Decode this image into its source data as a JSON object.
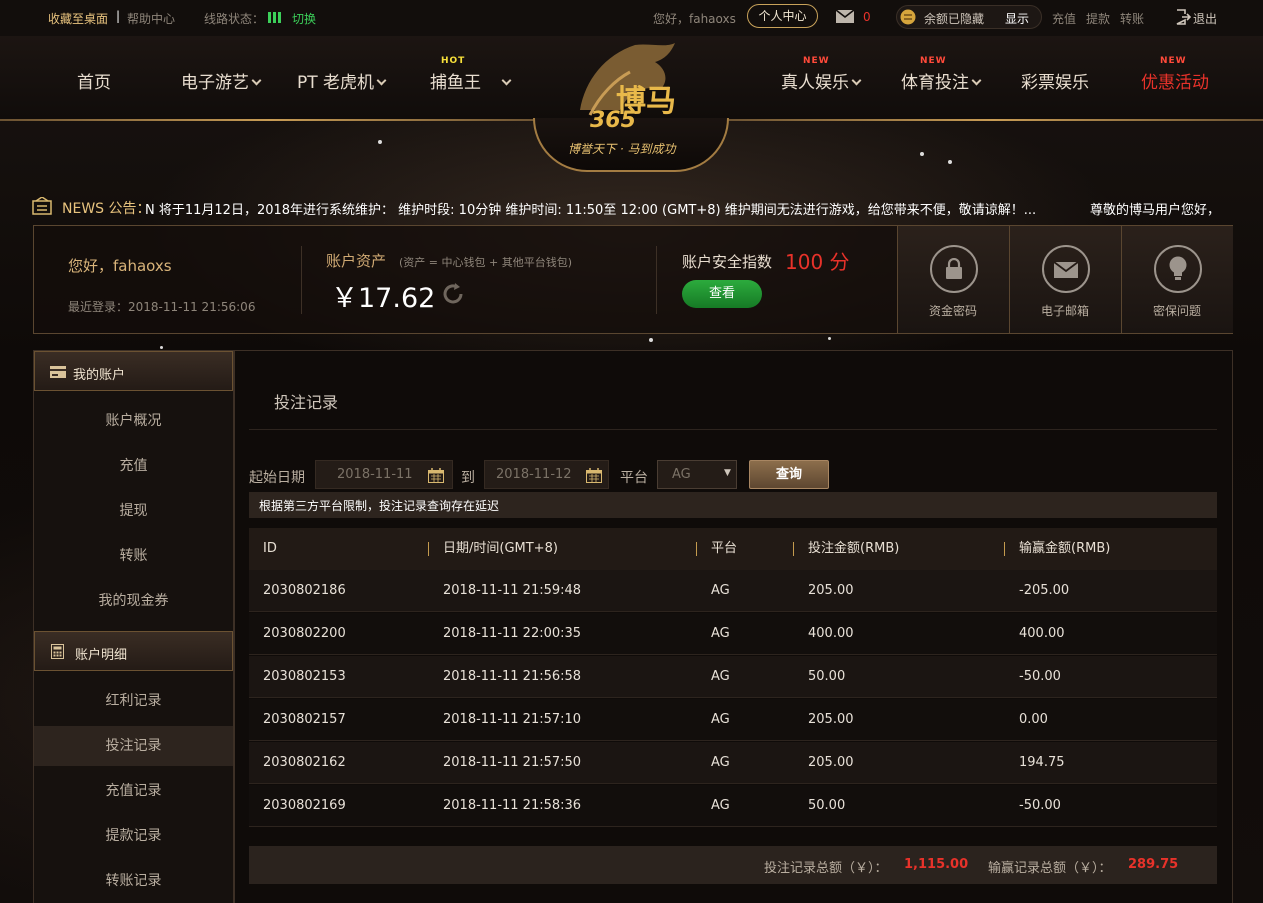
{
  "topbar": {
    "bookmark": "收藏至桌面",
    "help": "帮助中心",
    "line_status_label": "线路状态：",
    "switch": "切换",
    "greeting": "您好，fahaoxs",
    "personal_center": "个人中心",
    "mail_count": "0",
    "balance_hidden": "余额已隐藏",
    "show": "显示",
    "deposit": "充值",
    "withdraw": "提款",
    "transfer": "转账",
    "logout": "退出"
  },
  "nav": {
    "items": [
      {
        "label": "首页"
      },
      {
        "label": "电子游艺"
      },
      {
        "label": "PT 老虎机"
      },
      {
        "label": "捕鱼王",
        "badge": "HOT"
      },
      {
        "label": "真人娱乐",
        "badge": "NEW"
      },
      {
        "label": "体育投注",
        "badge": "NEW"
      },
      {
        "label": "彩票娱乐"
      },
      {
        "label": "优惠活动",
        "badge": "NEW"
      }
    ],
    "logo_text": "博马",
    "logo_number": "365",
    "logo_slogan": "博誉天下 · 马到成功"
  },
  "news": {
    "label": "NEWS 公告：",
    "text": "N 将于11月12日，2018年进行系统维护： 维护时段: 10分钟 维护时间: 11:50至 12:00 (GMT+8) 维护期间无法进行游戏，给您带来不便，敬请谅解！...",
    "text2": "尊敬的博马用户您好，"
  },
  "account": {
    "greeting": "您好，fahaoxs",
    "last_login": "最近登录：2018-11-11 21:56:06",
    "assets_label": "账户资产",
    "assets_note": "(资产 = 中心钱包 + 其他平台钱包)",
    "balance": "￥17.62",
    "security_label": "账户安全指数",
    "security_score": "100 分",
    "check_button": "查看",
    "icons": [
      {
        "label": "资金密码",
        "icon": "lock-icon"
      },
      {
        "label": "电子邮箱",
        "icon": "mail-icon"
      },
      {
        "label": "密保问题",
        "icon": "bulb-icon"
      }
    ]
  },
  "sidebar": {
    "section1": "我的账户",
    "items1": [
      "账户概况",
      "充值",
      "提现",
      "转账",
      "我的现金券"
    ],
    "section2": "账户明细",
    "items2": [
      "红利记录",
      "投注记录",
      "充值记录",
      "提款记录",
      "转账记录"
    ]
  },
  "main": {
    "title": "投注记录",
    "start_label": "起始日期",
    "start_value": "2018-11-11",
    "to_label": "到",
    "end_value": "2018-11-12",
    "platform_label": "平台",
    "platform_value": "AG",
    "query_button": "查询",
    "notice": "根据第三方平台限制，投注记录查询存在延迟",
    "columns": [
      "ID",
      "日期/时间(GMT+8)",
      "平台",
      "投注金额(RMB)",
      "输赢金额(RMB)"
    ],
    "rows": [
      [
        "2030802186",
        "2018-11-11 21:59:48",
        "AG",
        "205.00",
        "-205.00"
      ],
      [
        "2030802200",
        "2018-11-11 22:00:35",
        "AG",
        "400.00",
        "400.00"
      ],
      [
        "2030802153",
        "2018-11-11 21:56:58",
        "AG",
        "50.00",
        "-50.00"
      ],
      [
        "2030802157",
        "2018-11-11 21:57:10",
        "AG",
        "205.00",
        "0.00"
      ],
      [
        "2030802162",
        "2018-11-11 21:57:50",
        "AG",
        "205.00",
        "194.75"
      ],
      [
        "2030802169",
        "2018-11-11 21:58:36",
        "AG",
        "50.00",
        "-50.00"
      ]
    ],
    "total_bet_label": "投注记录总额（￥）：",
    "total_bet": "1,115.00",
    "total_win_label": "输赢记录总额（￥）：",
    "total_win": "289.75"
  },
  "colors": {
    "gold": "#e8c37e",
    "red": "#e8322a",
    "green": "#1f8f2f"
  }
}
